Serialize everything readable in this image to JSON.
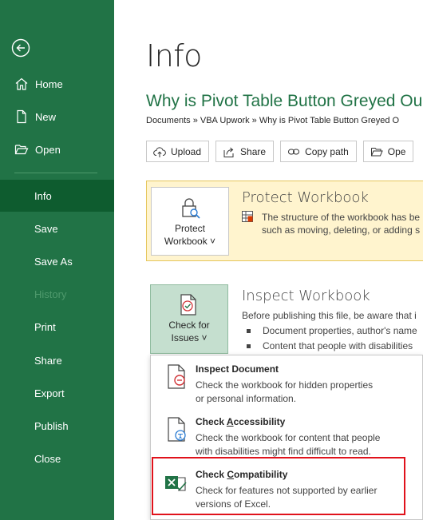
{
  "sidebar": {
    "items": [
      {
        "label": "Home",
        "icon": "home-icon"
      },
      {
        "label": "New",
        "icon": "new-document-icon"
      },
      {
        "label": "Open",
        "icon": "folder-open-icon"
      },
      {
        "label": "Info"
      },
      {
        "label": "Save"
      },
      {
        "label": "Save As"
      },
      {
        "label": "History"
      },
      {
        "label": "Print"
      },
      {
        "label": "Share"
      },
      {
        "label": "Export"
      },
      {
        "label": "Publish"
      },
      {
        "label": "Close"
      }
    ],
    "active_item": "Info",
    "disabled_item": "History",
    "bg_color": "#217346"
  },
  "page": {
    "title": "Info",
    "doc_title": "Why is Pivot Table Button Greyed Ou",
    "breadcrumb": "Documents » VBA Upwork » Why is Pivot Table Button Greyed O"
  },
  "actions": {
    "upload": "Upload",
    "share": "Share",
    "copy_path": "Copy path",
    "open": "Ope"
  },
  "protect": {
    "button_line1": "Protect",
    "button_line2": "Workbook ˅",
    "title": "Protect Workbook",
    "text_line1": "The structure of the workbook has be",
    "text_line2": "such as moving, deleting, or adding s"
  },
  "inspect": {
    "button_line1": "Check for",
    "button_line2": "Issues ˅",
    "title": "Inspect Workbook",
    "intro": "Before publishing this file, be aware that i",
    "bullet1": "Document properties, author's name",
    "bullet2": "Content that people with disabilities"
  },
  "menu": {
    "inspect_document": {
      "title_pre": "Inspect Document",
      "desc1": "Check the workbook for hidden properties",
      "desc2": "or personal information."
    },
    "check_accessibility": {
      "title_pre": "Check ",
      "title_ul": "A",
      "title_post": "ccessibility",
      "desc1": "Check the workbook for content that people",
      "desc2": "with disabilities might find difficult to read."
    },
    "check_compatibility": {
      "title_pre": "Check ",
      "title_ul": "C",
      "title_post": "ompatibility",
      "desc1": "Check for features not supported by earlier",
      "desc2": "versions of Excel."
    },
    "highlight_color": "#e0121b"
  }
}
